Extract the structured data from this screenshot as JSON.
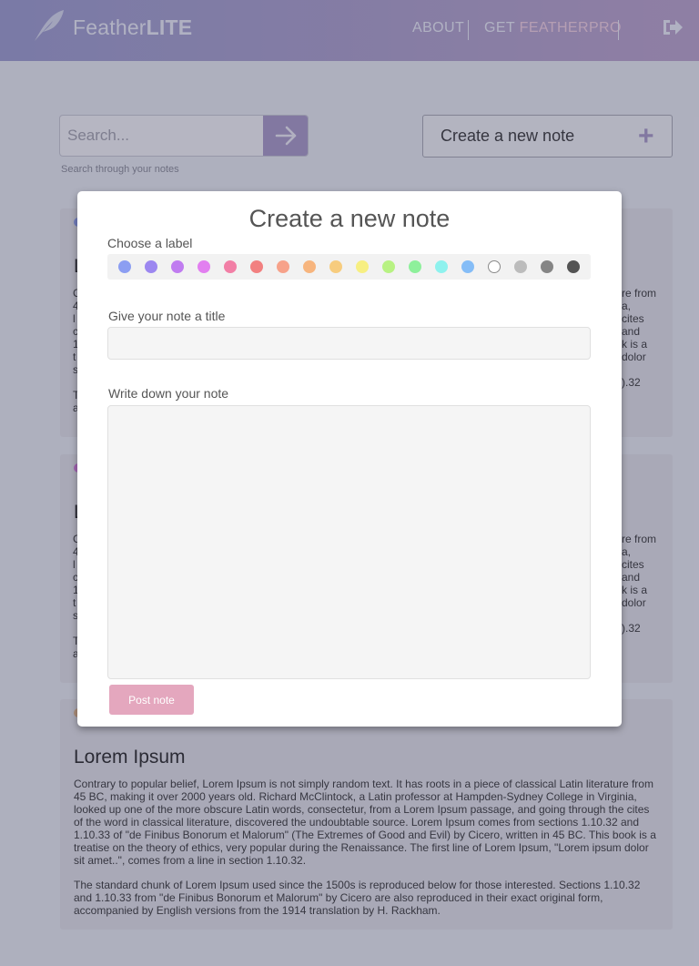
{
  "header": {
    "logo_light": "Feather",
    "logo_bold": "LITE",
    "nav_about": "ABOUT",
    "nav_get": "GET ",
    "nav_get_accent": "FEATHERPRO"
  },
  "search": {
    "placeholder": "Search...",
    "help": "Search through your notes"
  },
  "create_button": {
    "label": "Create a new note",
    "icon": "+"
  },
  "cards": [
    {
      "title": "Lorem Ipsum",
      "dot_color": "#e6b98a",
      "paragraph1": "Contrary to popular belief, Lorem Ipsum is not simply random text. It has roots in a piece of classical Latin literature from 45 BC, making it over 2000 years old. Richard McClintock, a Latin professor at Hampden-Sydney College in Virginia, looked up one of the more obscure Latin words, consectetur, from a Lorem Ipsum passage, and going through the cites of the word in classical literature, discovered the undoubtable source. Lorem Ipsum comes from sections 1.10.32 and 1.10.33 of \"de Finibus Bonorum et Malorum\" (The Extremes of Good and Evil) by Cicero, written in 45 BC. This book is a treatise on the theory of ethics, very popular during the Renaissance. The first line of Lorem Ipsum, \"Lorem ipsum dolor sit amet..\", comes from a line in section 1.10.32.",
      "paragraph2": "The standard chunk of Lorem Ipsum used since the 1500s is reproduced below for those interested. Sections 1.10.32 and 1.10.33 from \"de Finibus Bonorum et Malorum\" by Cicero are also reproduced in their exact original form, accompanied by English versions from the 1914 translation by H. Rackham."
    }
  ],
  "card_fragments": {
    "first_card": {
      "dot_color": "#8c9ef2",
      "title_initial": "L",
      "left_initials": [
        "C",
        "4",
        "l",
        "c",
        "1",
        "t",
        "s",
        "",
        "T",
        "a"
      ],
      "right_fragments": [
        "re from",
        "a,",
        "cites",
        "and",
        "k is a",
        "dolor",
        "",
        ").32"
      ]
    },
    "second_card": {
      "dot_color": "#d77ae0",
      "title_initial": "L",
      "left_initials": [
        "C",
        "4",
        "l",
        "c",
        "1",
        "t",
        "s",
        "",
        "T",
        "a"
      ],
      "right_fragments": [
        "re from",
        "a,",
        "cites",
        "and",
        "k is a",
        "dolor",
        "",
        ").32"
      ]
    }
  },
  "modal": {
    "title": "Create a new note",
    "choose_label": "Choose a label",
    "title_label": "Give your note a title",
    "note_label": "Write down your note",
    "post_button": "Post note",
    "title_value": "",
    "note_value": "",
    "label_colors": [
      "#8c9ef2",
      "#9c87f0",
      "#c07cf0",
      "#e27ff0",
      "#f27fa6",
      "#f28080",
      "#f7a28a",
      "#f7b57e",
      "#f7cc7e",
      "#f7ef82",
      "#b8f283",
      "#8ef09b",
      "#8ef2ee",
      "#85bdf7",
      "#ffffff",
      "#bcbcbc",
      "#858585",
      "#545454"
    ]
  }
}
